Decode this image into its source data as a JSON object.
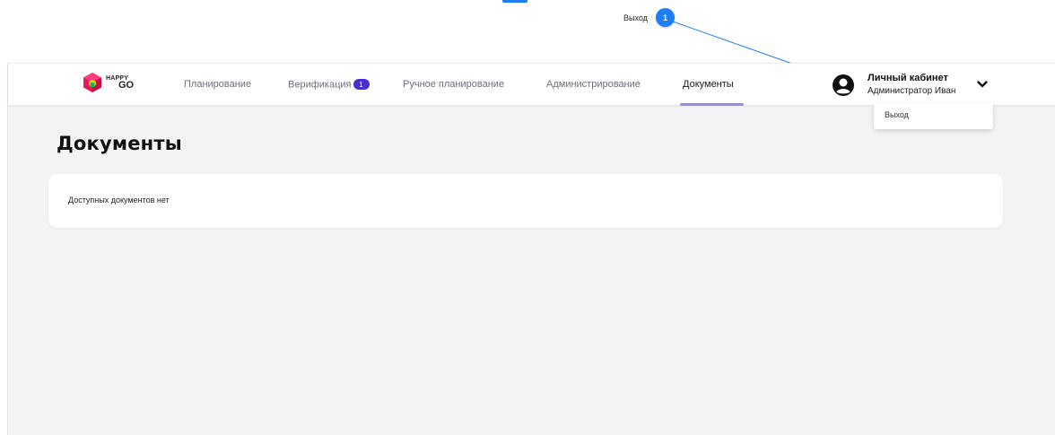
{
  "annotation": {
    "label": "Выход",
    "badge": "1",
    "accent_color": "#1f7ef5"
  },
  "header": {
    "logo": {
      "line1": "HAPPY",
      "line2": "GO",
      "icon": "happygo-cube-logo"
    },
    "nav": [
      {
        "label": "Планирование",
        "active": false
      },
      {
        "label": "Верификация",
        "badge": "1",
        "active": false
      },
      {
        "label": "Ручное планирование",
        "active": false
      },
      {
        "label": "Администрирование",
        "active": false
      },
      {
        "label": "Документы",
        "active": true
      }
    ],
    "profile": {
      "title": "Личный кабинет",
      "subtitle": "Администратор Иван",
      "icon": "user-circle-icon",
      "toggle_icon": "chevron-down-icon"
    },
    "dropdown": {
      "items": [
        {
          "label": "Выход"
        }
      ]
    }
  },
  "main": {
    "title": "Документы",
    "empty_text": "Доступных документов нет"
  },
  "colors": {
    "nav_active_underline": "#8f8fe6",
    "badge": "#4b2bd6",
    "background": "#f2f3f5"
  }
}
